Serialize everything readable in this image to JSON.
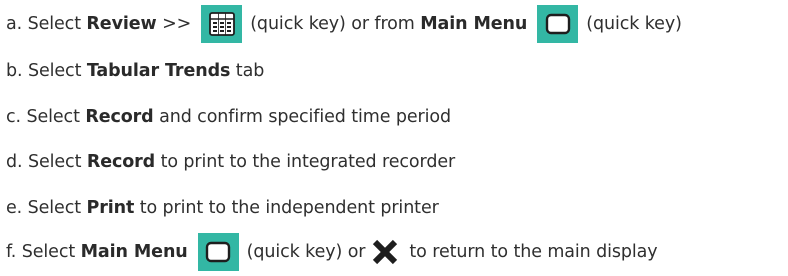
{
  "steps": [
    {
      "marker": "a.",
      "t1": "Select ",
      "b1": "Review",
      "t2": " >>",
      "key1_icon": "review-trends-icon",
      "t3": "(quick key) or from ",
      "b2": "Main Menu",
      "key2_icon": "main-menu-icon",
      "t4": "(quick key)"
    },
    {
      "marker": "b.",
      "t1": "Select ",
      "b1": "Tabular Trends",
      "t2": " tab"
    },
    {
      "marker": "c.",
      "t1": "Select ",
      "b1": "Record",
      "t2": " and confirm specified time period"
    },
    {
      "marker": "d.",
      "t1": "Select ",
      "b1": "Record",
      "t2": " to print to the integrated recorder"
    },
    {
      "marker": "e.",
      "t1": "Select ",
      "b1": "Print",
      "t2": " to print to the independent printer"
    },
    {
      "marker": "f.",
      "t1": "Select ",
      "b1": "Main Menu",
      "key_icon": "main-menu-icon",
      "t2": "(quick key) or",
      "x_icon": "close-x-icon",
      "t3": "to return to the main display"
    }
  ],
  "colors": {
    "quick_key_bg": "#33b7a4",
    "text": "#2f2f2f",
    "icon_fg": "#1e1e1e"
  }
}
